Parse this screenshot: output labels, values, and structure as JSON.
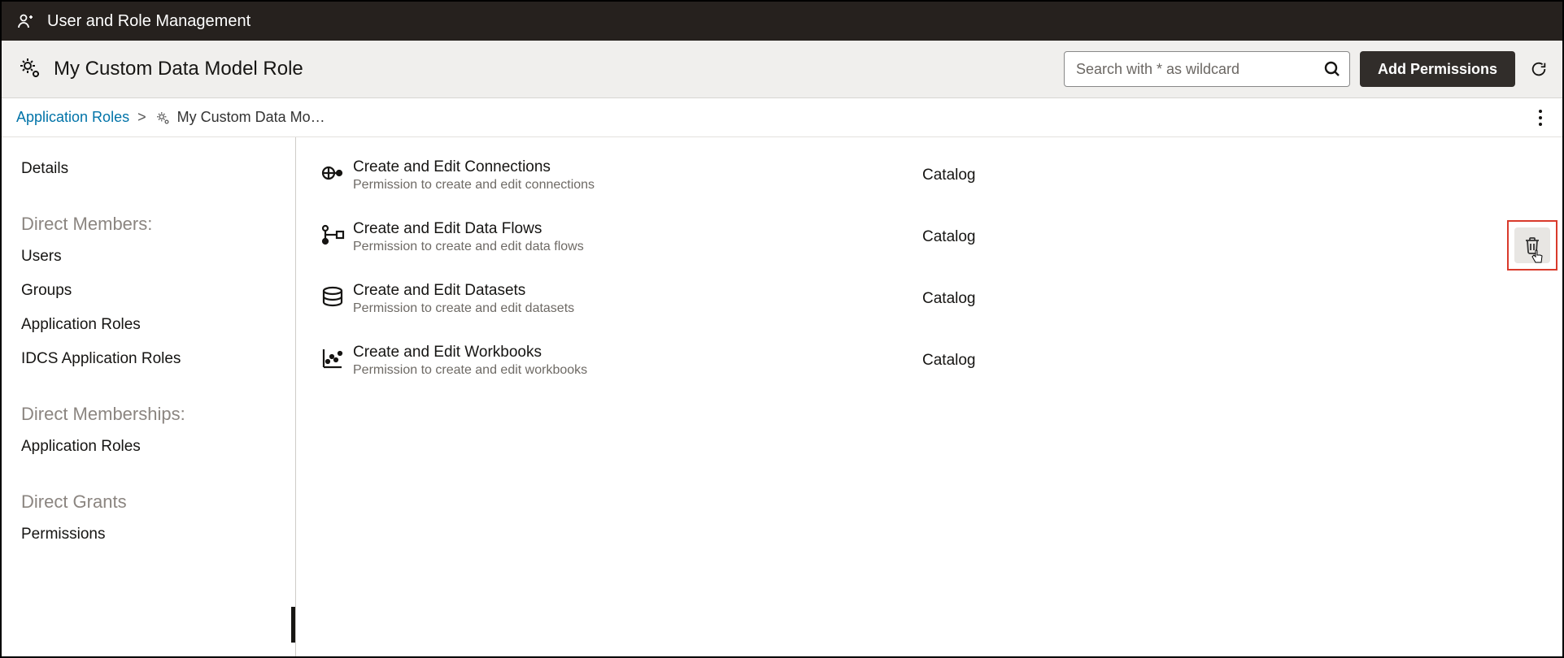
{
  "titlebar": {
    "title": "User and Role Management"
  },
  "subheader": {
    "title": "My Custom Data Model Role",
    "search_placeholder": "Search with * as wildcard",
    "add_permissions_label": "Add Permissions"
  },
  "breadcrumb": {
    "parent": "Application Roles",
    "sep": ">",
    "current": "My Custom Data Mo…"
  },
  "sidebar": {
    "details": "Details",
    "heading_members": "Direct Members:",
    "users": "Users",
    "groups": "Groups",
    "app_roles": "Application Roles",
    "idcs_app_roles": "IDCS Application Roles",
    "heading_memberships": "Direct Memberships:",
    "memberships_app_roles": "Application Roles",
    "heading_grants": "Direct Grants",
    "permissions": "Permissions"
  },
  "permissions": [
    {
      "title": "Create and Edit Connections",
      "desc": "Permission to create and edit connections",
      "category": "Catalog"
    },
    {
      "title": "Create and Edit Data Flows",
      "desc": "Permission to create and edit data flows",
      "category": "Catalog"
    },
    {
      "title": "Create and Edit Datasets",
      "desc": "Permission to create and edit datasets",
      "category": "Catalog"
    },
    {
      "title": "Create and Edit Workbooks",
      "desc": "Permission to create and edit workbooks",
      "category": "Catalog"
    }
  ]
}
